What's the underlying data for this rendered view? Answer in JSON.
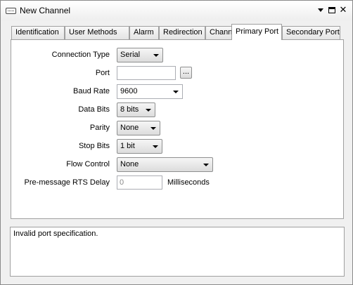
{
  "window": {
    "title": "New Channel",
    "close_glyph": "✕",
    "icons": [
      "channel-icon",
      "dropdown-arrow-icon",
      "maximize-icon",
      "close-icon"
    ]
  },
  "tabs": [
    {
      "label": "Identification"
    },
    {
      "label": "User Methods"
    },
    {
      "label": "Alarm"
    },
    {
      "label": "Redirection"
    },
    {
      "label": "Channel"
    },
    {
      "label": "Primary Port",
      "active": true
    },
    {
      "label": "Secondary Port"
    }
  ],
  "form": {
    "connection_type": {
      "label": "Connection Type",
      "value": "Serial"
    },
    "port": {
      "label": "Port",
      "value": "",
      "browse": "..."
    },
    "baud_rate": {
      "label": "Baud Rate",
      "value": "9600"
    },
    "data_bits": {
      "label": "Data Bits",
      "value": "8 bits"
    },
    "parity": {
      "label": "Parity",
      "value": "None"
    },
    "stop_bits": {
      "label": "Stop Bits",
      "value": "1 bit"
    },
    "flow_control": {
      "label": "Flow Control",
      "value": "None"
    },
    "rts_delay": {
      "label": "Pre-message RTS Delay",
      "value": "0",
      "unit": "Milliseconds"
    }
  },
  "status": {
    "message": "Invalid port specification."
  }
}
